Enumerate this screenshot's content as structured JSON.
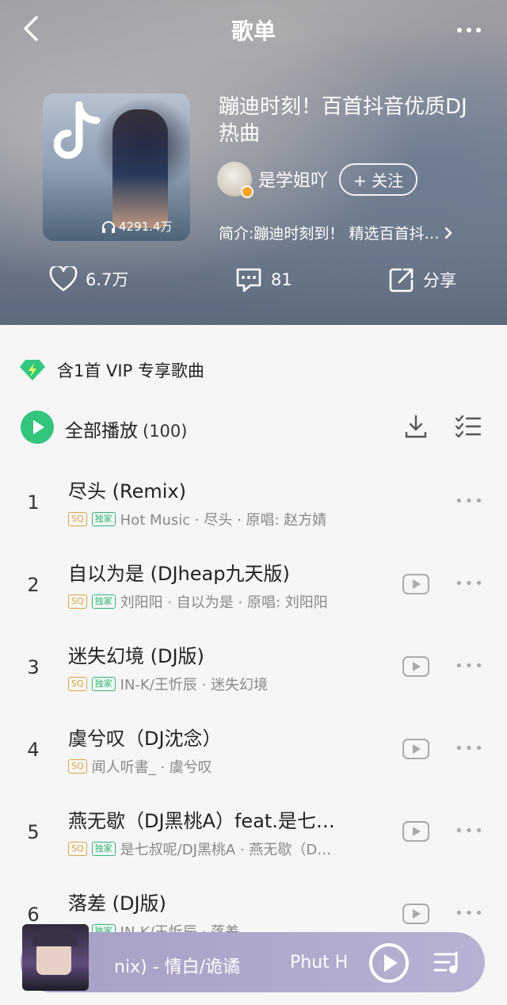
{
  "header": {
    "title": "歌单"
  },
  "playlist": {
    "title": "蹦迪时刻！百首抖音优质DJ热曲",
    "play_count": "4291.4万",
    "creator_name": "是学姐吖",
    "follow_label": "+ 关注",
    "intro": "简介:蹦迪时刻到！ 精选百首抖…"
  },
  "actions": {
    "likes": "6.7万",
    "comments": "81",
    "share": "分享"
  },
  "vip_notice": "含1首 VIP 专享歌曲",
  "play_all": {
    "label": "全部播放",
    "count": "(100)"
  },
  "tags": {
    "sq": "SQ",
    "exclusive": "独家"
  },
  "songs": [
    {
      "index": "1",
      "title": "尽头 (Remix)",
      "meta": "Hot Music · 尽头 · 原唱: 赵方婧"
    },
    {
      "index": "2",
      "title": "自以为是 (DJheap九天版)",
      "meta": "刘阳阳 · 自以为是 · 原唱: 刘阳阳"
    },
    {
      "index": "3",
      "title": "迷失幻境 (DJ版)",
      "meta": "IN-K/王忻辰 · 迷失幻境"
    },
    {
      "index": "4",
      "title": "虞兮叹（DJ沈念）",
      "meta": "闻人听書_ · 虞兮叹"
    },
    {
      "index": "5",
      "title": "燕无歇（DJ黑桃A）feat.是七…",
      "meta": "是七叔呢/DJ黑桃A · 燕无歇（D…"
    },
    {
      "index": "6",
      "title": "落差 (DJ版)",
      "meta": "IN-K/王忻辰 · 落差"
    }
  ],
  "now_playing": {
    "text": "nix) - 情白/诡谲",
    "next_text": "Phut H"
  },
  "colors": {
    "accent_green": "#33c47e",
    "sq_tag": "#d9a441",
    "exclusive_tag": "#2fb874",
    "player_bg": "#b0a9cc"
  }
}
